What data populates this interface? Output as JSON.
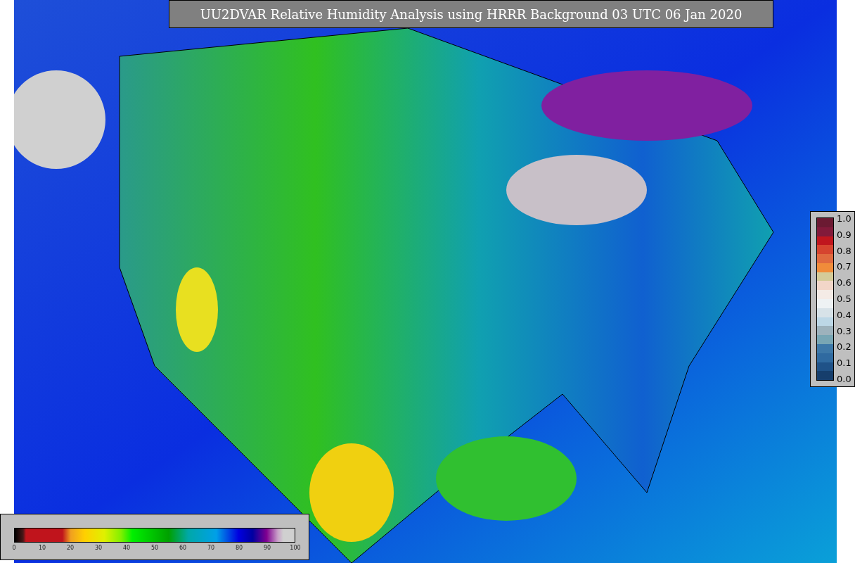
{
  "title": "UU2DVAR Relative Humidity Analysis using HRRR Background 03 UTC 06 Jan 2020",
  "humidity_colorbar": {
    "ticks": [
      "0",
      "10",
      "20",
      "30",
      "40",
      "50",
      "60",
      "70",
      "80",
      "90",
      "100"
    ]
  },
  "side_colorbar": {
    "ticks": [
      "1.0",
      "0.9",
      "0.8",
      "0.7",
      "0.6",
      "0.5",
      "0.4",
      "0.3",
      "0.2",
      "0.1",
      "0.0"
    ]
  }
}
